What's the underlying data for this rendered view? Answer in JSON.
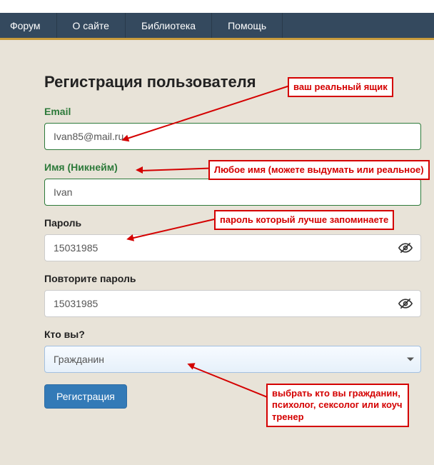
{
  "navbar": {
    "items": [
      "Форум",
      "О сайте",
      "Библиотека",
      "Помощь"
    ]
  },
  "form": {
    "title": "Регистрация пользователя",
    "email_label": "Email",
    "email_value": "Ivan85@mail.ru",
    "name_label": "Имя (Никнейм)",
    "name_value": "Ivan",
    "password_label": "Пароль",
    "password_value": "15031985",
    "confirm_label": "Повторите пароль",
    "confirm_value": "15031985",
    "role_label": "Кто вы?",
    "role_value": "Гражданин",
    "submit_label": "Регистрация"
  },
  "annotations": {
    "email": "ваш реальный ящик",
    "name": "Любое имя (можете выдумать или реальное)",
    "password": "пароль который лучше запоминаете",
    "role": "выбрать кто вы гражданин, психолог, сексолог или коуч тренер"
  }
}
